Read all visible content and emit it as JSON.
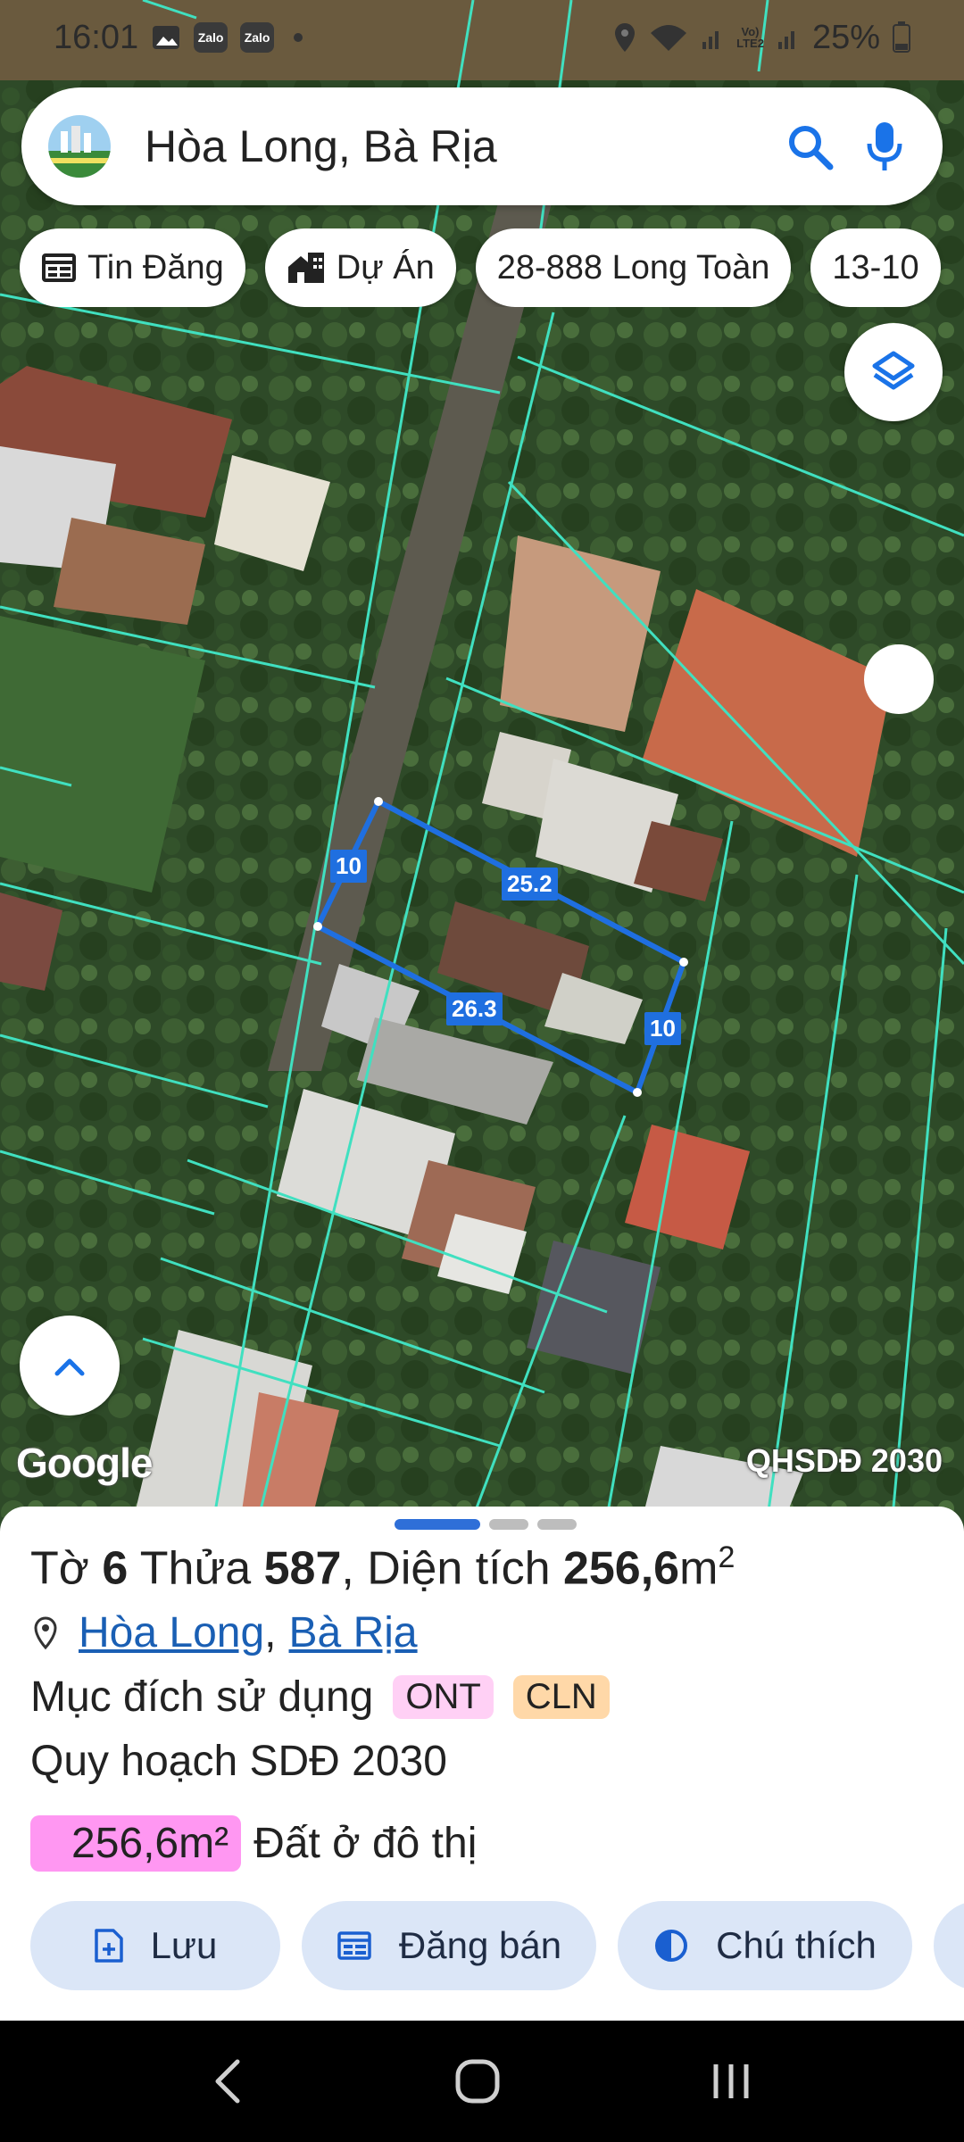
{
  "status_bar": {
    "time": "16:01",
    "notification_icons": [
      "image-icon",
      "zalo-icon",
      "zalo-icon",
      "dot-icon"
    ],
    "app_icon_label": "Zalo",
    "volte_line1": "Vo)",
    "volte_line2": "LTE2",
    "battery": "25%"
  },
  "search": {
    "query": "Hòa Long, Bà Rịa",
    "icons": [
      "app-logo-icon",
      "search-icon",
      "mic-icon"
    ]
  },
  "chips": [
    {
      "label": "Tin Đăng",
      "icon": "listing-icon"
    },
    {
      "label": "Dự Án",
      "icon": "project-icon"
    },
    {
      "label": "28-888 Long Toàn"
    },
    {
      "label": "13-10"
    }
  ],
  "map": {
    "google_label": "Google",
    "plan_label": "QHSDĐ 2030",
    "dimensions": [
      "10",
      "25.2",
      "26.3",
      "10"
    ],
    "highlight_color": "#1f6fe0",
    "boundary_color": "#40e0c0"
  },
  "parcel": {
    "to_label": "Tờ",
    "to_number": "6",
    "thua_label": "Thửa",
    "thua_number": "587",
    "area_label": ", Diện tích",
    "area_value": "256,6",
    "area_unit": "m",
    "area_unit_sup": "2",
    "location_ward": "Hòa Long",
    "location_sep": ",",
    "location_city": "Bà Rịa",
    "purpose_label": "Mục đích sử dụng",
    "purpose_tags": [
      "ONT",
      "CLN"
    ],
    "plan_title": "Quy hoạch SDĐ 2030",
    "plan_area": "256,6m²",
    "plan_desc": "Đất ở đô thị"
  },
  "actions": [
    {
      "label": "Lưu",
      "icon": "save-doc-icon"
    },
    {
      "label": "Đăng bán",
      "icon": "post-listing-icon"
    },
    {
      "label": "Chú thích",
      "icon": "contrast-icon"
    }
  ],
  "nav": [
    "back-icon",
    "home-icon",
    "recents-icon"
  ]
}
